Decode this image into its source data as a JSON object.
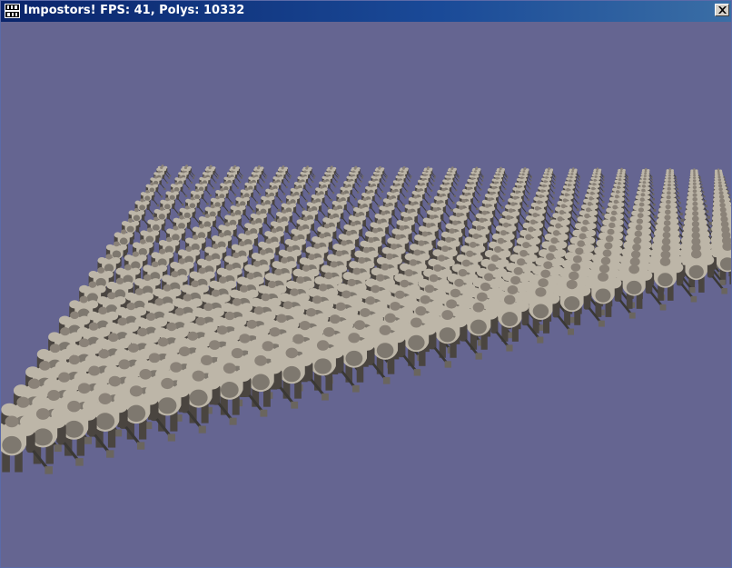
{
  "window": {
    "title": "Impostors! FPS: 41, Polys: 10332",
    "icon": "irrlicht-app-icon",
    "close_glyph": "close-icon"
  },
  "viewport": {
    "background_color": "#656591",
    "content": "3d-scene-grid-of-armored-warriors"
  },
  "colors": {
    "titlebar_start": "#0a246a",
    "titlebar_end": "#3a6ea5",
    "figure_light": "#bdb6a8",
    "figure_dark": "#4a4540"
  }
}
